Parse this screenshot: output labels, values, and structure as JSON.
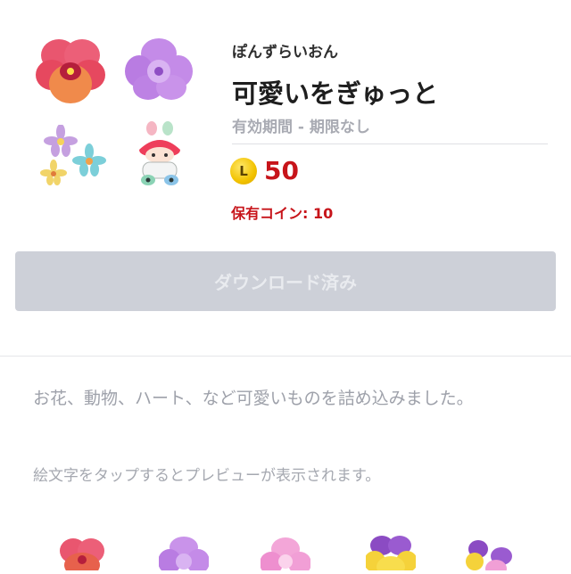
{
  "product": {
    "author": "ぽんずらいおん",
    "title": "可愛いをぎゅっと",
    "validity": "有効期間 - 期限なし",
    "coin_icon_letter": "L",
    "price": "50",
    "owned_coins_label": "保有コイン: ",
    "owned_coins_value": "10",
    "price_color": "#c7141a"
  },
  "thumbnails": [
    {
      "name": "red-pansy-icon"
    },
    {
      "name": "purple-flower-icon"
    },
    {
      "name": "flower-cluster-icon"
    },
    {
      "name": "cute-character-icon"
    }
  ],
  "download_button": {
    "label": "ダウンロード済み",
    "state": "disabled"
  },
  "description": "お花、動物、ハート、など可愛いものを詰め込みました。",
  "preview_hint": "絵文字をタップするとプレビューが表示されます。",
  "preview_emojis": [
    {
      "name": "red-pansy-emoji-icon"
    },
    {
      "name": "purple-flower-emoji-icon"
    },
    {
      "name": "pink-flower-emoji-icon"
    },
    {
      "name": "yellow-pansy-emoji-icon"
    },
    {
      "name": "violet-pansy-emoji-icon"
    }
  ]
}
